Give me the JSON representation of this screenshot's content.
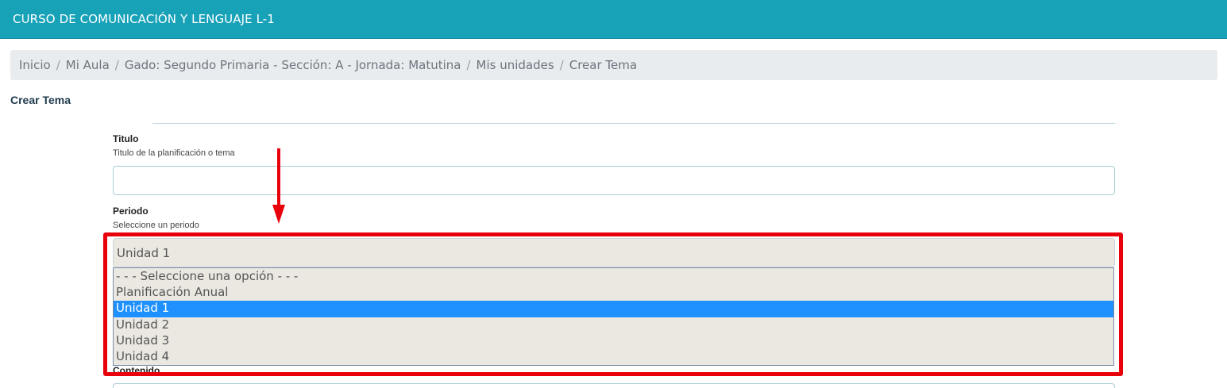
{
  "header": {
    "title": "CURSO DE COMUNICACIÓN Y LENGUAJE L-1"
  },
  "breadcrumb": {
    "items": [
      "Inicio",
      "Mi Aula",
      "Gado: Segundo Primaria - Sección: A - Jornada: Matutina",
      "Mis unidades",
      "Crear Tema"
    ],
    "separator": "/"
  },
  "page": {
    "title": "Crear Tema"
  },
  "form": {
    "titulo": {
      "label": "Titulo",
      "help": "Titulo de la planificación o tema",
      "value": ""
    },
    "periodo": {
      "label": "Periodo",
      "help": "Seleccione un periodo",
      "selected": "Unidad 1",
      "options": [
        "- - - Seleccione una opción - - -",
        "Planificación Anual",
        "Unidad 1",
        "Unidad 2",
        "Unidad 3",
        "Unidad 4"
      ],
      "selected_index": 2
    },
    "contenido": {
      "label": "Contenido"
    }
  },
  "annotation": {
    "color": "#e8000b"
  },
  "colors": {
    "header_bg": "#17a2b8",
    "selected_option_bg": "#1e90ff"
  }
}
